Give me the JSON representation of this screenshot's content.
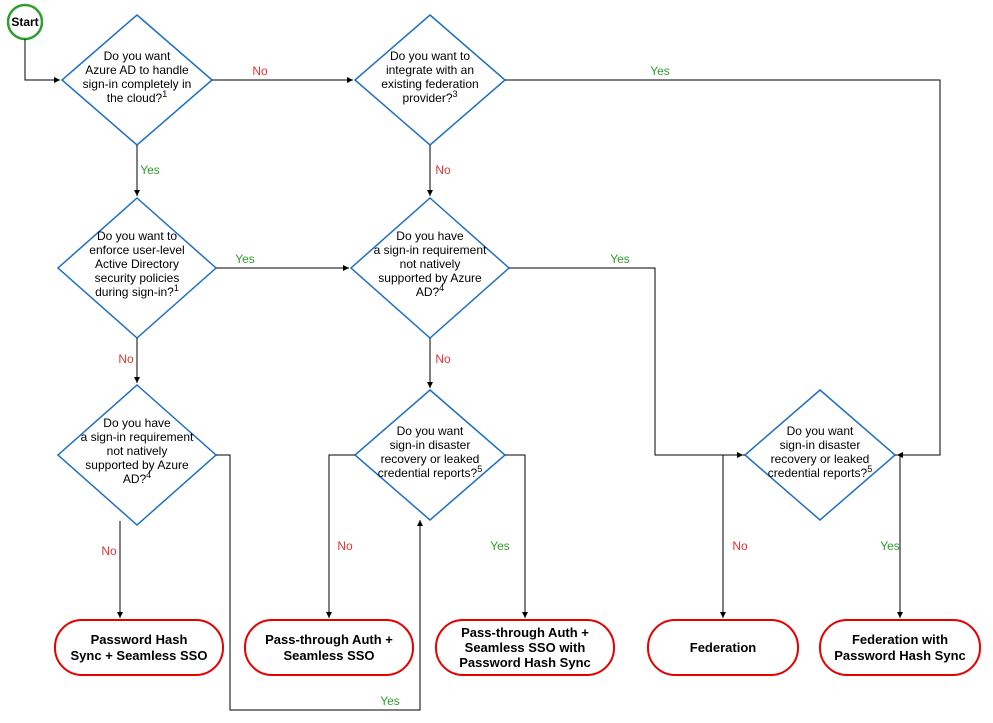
{
  "start": {
    "label": "Start"
  },
  "decisions": {
    "d1": {
      "l1": "Do you want",
      "l2": "Azure AD to handle",
      "l3": "sign-in completely in",
      "l4": "the cloud?",
      "sup": "1"
    },
    "d2": {
      "l1": "Do you want to",
      "l2": "integrate with an",
      "l3": "existing federation",
      "l4": "provider?",
      "sup": "3"
    },
    "d3": {
      "l1": "Do you want to",
      "l2": "enforce user-level",
      "l3": "Active Directory",
      "l4": "security policies",
      "l5": "during sign-in?",
      "sup": "1"
    },
    "d4": {
      "l1": "Do you have",
      "l2": "a sign-in requirement",
      "l3": "not natively",
      "l4": "supported by Azure",
      "l5": "AD?",
      "sup": "4"
    },
    "d5": {
      "l1": "Do you have",
      "l2": "a sign-in requirement",
      "l3": "not natively",
      "l4": "supported by Azure",
      "l5": "AD?",
      "sup": "4"
    },
    "d6": {
      "l1": "Do you want",
      "l2": "sign-in disaster",
      "l3": "recovery or leaked",
      "l4": "credential reports?",
      "sup": "5"
    },
    "d7": {
      "l1": "Do you want",
      "l2": "sign-in disaster",
      "l3": "recovery or leaked",
      "l4": "credential reports?",
      "sup": "5"
    }
  },
  "results": {
    "r1": {
      "l1": "Password Hash",
      "l2": "Sync + Seamless SSO"
    },
    "r2": {
      "l1": "Pass-through Auth +",
      "l2": "Seamless SSO"
    },
    "r3": {
      "l1": "Pass-through Auth +",
      "l2": "Seamless SSO with",
      "l3": "Password Hash Sync"
    },
    "r4": {
      "l1": "Federation"
    },
    "r5": {
      "l1": "Federation with",
      "l2": "Password Hash Sync"
    }
  },
  "labels": {
    "yes": "Yes",
    "no": "No"
  },
  "colors": {
    "diamond_stroke": "#1f6fc0",
    "start_stroke": "#2e9e2e",
    "result_stroke": "#e60000",
    "yes": "#2e9e2e",
    "no": "#d93636"
  }
}
